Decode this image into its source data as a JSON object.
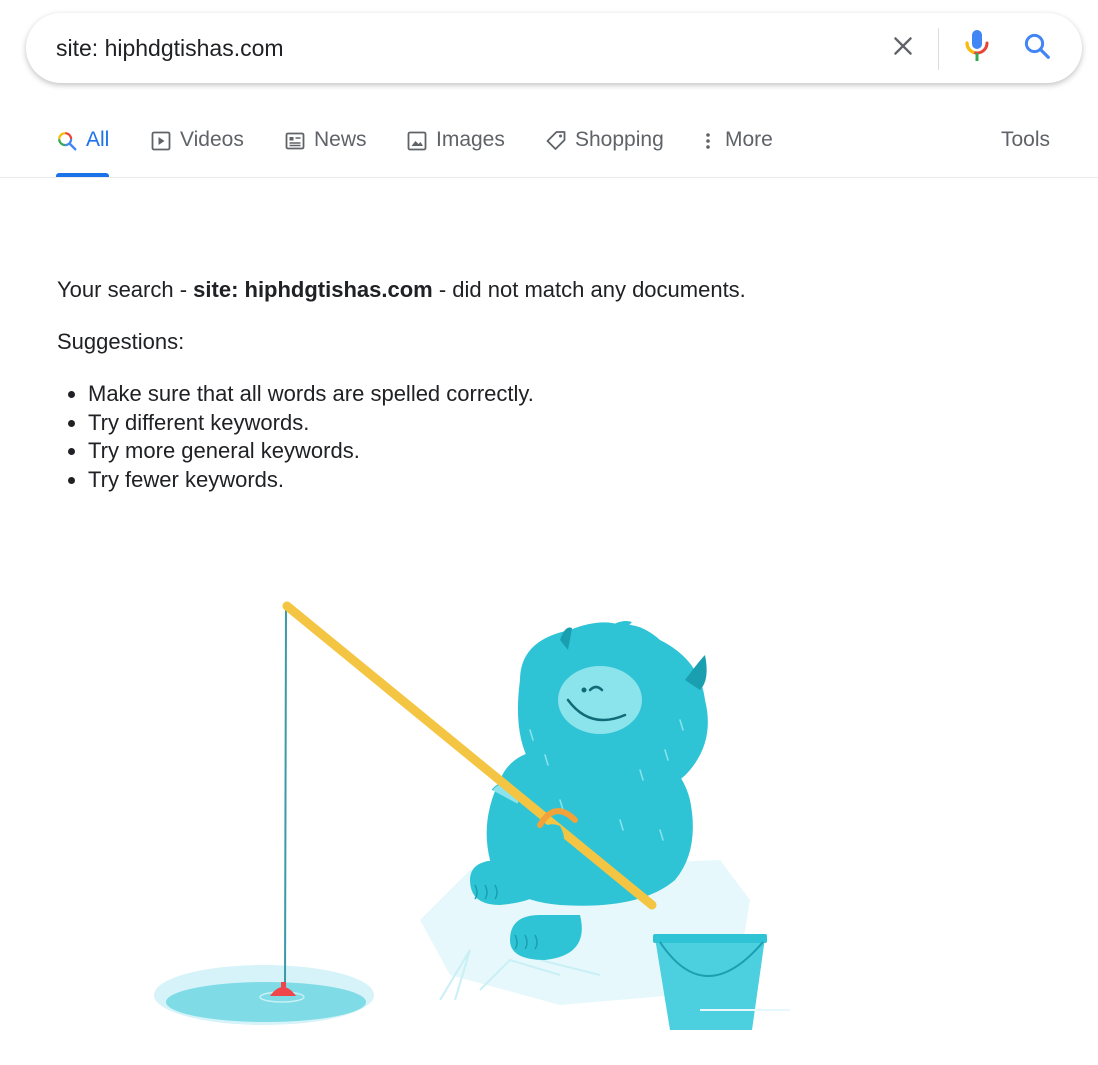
{
  "search": {
    "query": "site: hiphdgtishas.com"
  },
  "tabs": [
    {
      "label": "All",
      "icon": "search-icon",
      "active": true
    },
    {
      "label": "Videos",
      "icon": "video-icon"
    },
    {
      "label": "News",
      "icon": "news-icon"
    },
    {
      "label": "Images",
      "icon": "image-icon"
    },
    {
      "label": "Shopping",
      "icon": "tag-icon"
    },
    {
      "label": "More",
      "icon": "more-vert-icon"
    }
  ],
  "tools_label": "Tools",
  "results": {
    "message_prefix": "Your search - ",
    "message_query": "site: hiphdgtishas.com",
    "message_suffix": " - did not match any documents.",
    "suggestions_title": "Suggestions:",
    "suggestions": [
      "Make sure that all words are spelled correctly.",
      "Try different keywords.",
      "Try more general keywords.",
      "Try fewer keywords."
    ]
  },
  "colors": {
    "accent": "#1a73e8",
    "text": "#202124",
    "secondary_text": "#5f6368",
    "creature": "#2ec4d6",
    "rod": "#f4c542",
    "bobber": "#f0454a"
  }
}
